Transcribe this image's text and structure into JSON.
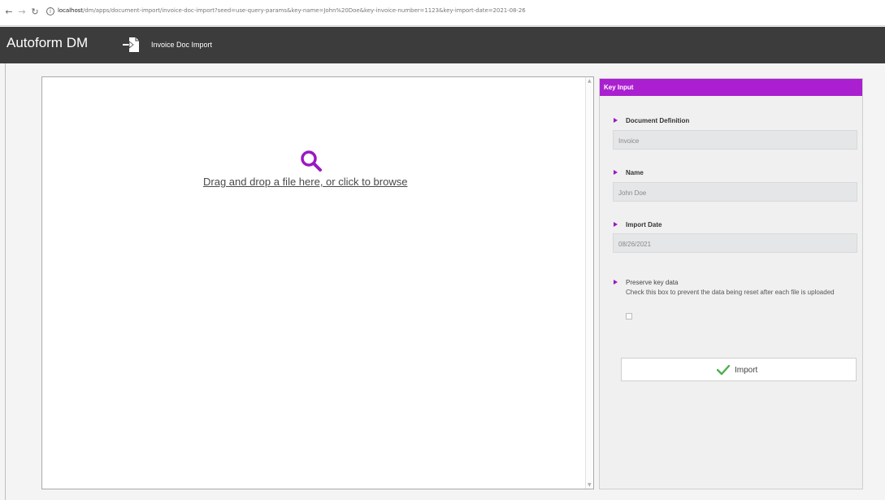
{
  "browser": {
    "url_host": "localhost",
    "url_path": "/dm/apps/document-import/invoice-doc-import?seed=use-query-params&key-name=John%20Doe&key-invoice-number=1123&key-import-date=2021-08-26",
    "icons": {
      "back": "arrow-left-icon",
      "forward": "arrow-right-icon",
      "reload": "reload-icon",
      "info": "info-icon"
    }
  },
  "app": {
    "brand": "Autoform DM",
    "page_title": "Invoice Doc Import",
    "header_color": "#3c3c3c"
  },
  "dropzone": {
    "text": "Drag and drop a file here, or click to browse",
    "icon": "search-icon",
    "icon_color": "#9a18c4"
  },
  "key_input": {
    "title": "Key Input",
    "accent_color": "#aa20d0",
    "fields": [
      {
        "label": "Document Definition",
        "value": "Invoice"
      },
      {
        "label": "Name",
        "value": "John Doe"
      },
      {
        "label": "Import Date",
        "value": "08/26/2021"
      }
    ],
    "preserve": {
      "label": "Preserve key data",
      "help": "Check this box to prevent the data being reset after each file is uploaded",
      "checked": false
    },
    "import_button": {
      "label": "Import",
      "icon": "check-icon",
      "icon_color": "#4caf50"
    }
  }
}
